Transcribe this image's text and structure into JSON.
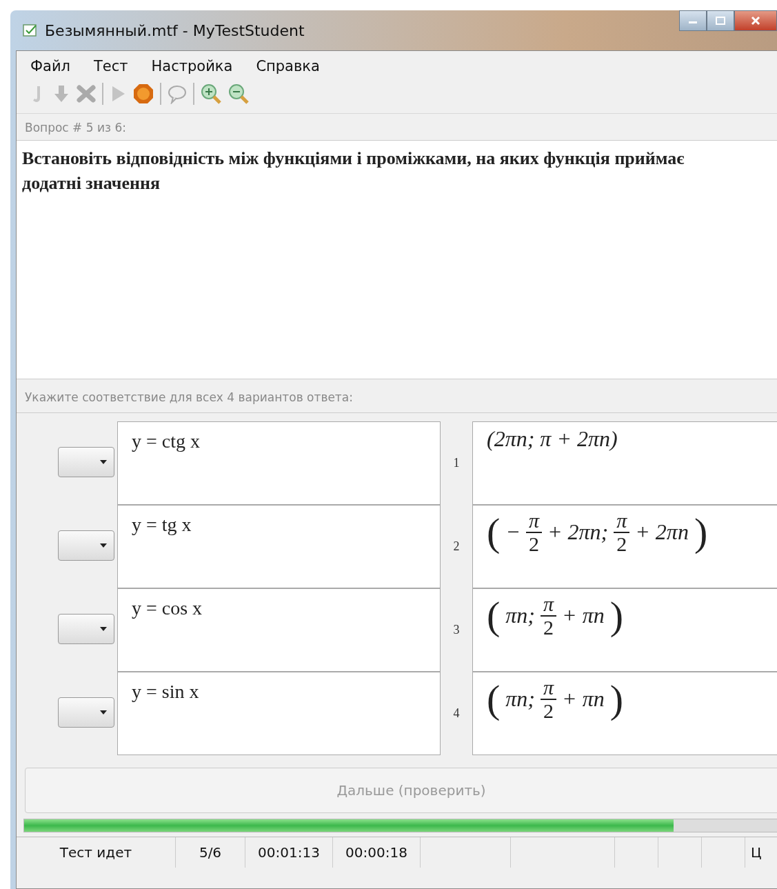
{
  "window": {
    "title": "Безымянный.mtf - MyTestStudent"
  },
  "menu": [
    "Файл",
    "Тест",
    "Настройка",
    "Справка"
  ],
  "question": {
    "header": "Вопрос # 5 из 6:",
    "text": "Встановіть відповідність між функціями і проміжками, на яких функція приймає додатні значення"
  },
  "instruction": "Укажите соответствие для всех 4 вариантов ответа:",
  "items": [
    {
      "text": "y = ctg x"
    },
    {
      "text": "y = tg x"
    },
    {
      "text": "y = cos x"
    },
    {
      "text": "y = sin x"
    }
  ],
  "options": [
    {
      "number": "1",
      "parts": [
        {
          "kind": "text",
          "text": "(2πn; π + 2πn)"
        }
      ]
    },
    {
      "number": "2",
      "parts": [
        {
          "kind": "paren",
          "text": "("
        },
        {
          "kind": "text",
          "text": "−"
        },
        {
          "kind": "frac",
          "num": "π",
          "den": "2"
        },
        {
          "kind": "text",
          "text": "+ 2πn;"
        },
        {
          "kind": "frac",
          "num": "π",
          "den": "2"
        },
        {
          "kind": "text",
          "text": "+ 2πn"
        },
        {
          "kind": "paren",
          "text": ")"
        }
      ]
    },
    {
      "number": "3",
      "parts": [
        {
          "kind": "paren",
          "text": "("
        },
        {
          "kind": "text",
          "text": "πn;"
        },
        {
          "kind": "frac",
          "num": "π",
          "den": "2"
        },
        {
          "kind": "text",
          "text": "+ πn"
        },
        {
          "kind": "paren",
          "text": ")"
        }
      ]
    },
    {
      "number": "4",
      "parts": [
        {
          "kind": "paren",
          "text": "("
        },
        {
          "kind": "text",
          "text": "πn;"
        },
        {
          "kind": "frac",
          "num": "π",
          "den": "2"
        },
        {
          "kind": "text",
          "text": "+ πn"
        },
        {
          "kind": "paren",
          "text": ")"
        }
      ]
    }
  ],
  "next_button": {
    "label": "Дальше (проверить)",
    "disabled": true
  },
  "progress": {
    "level": 0.84
  },
  "status_bar": [
    "Тест идет",
    "5/6",
    "00:01:13",
    "00:00:18",
    "Ц"
  ]
}
